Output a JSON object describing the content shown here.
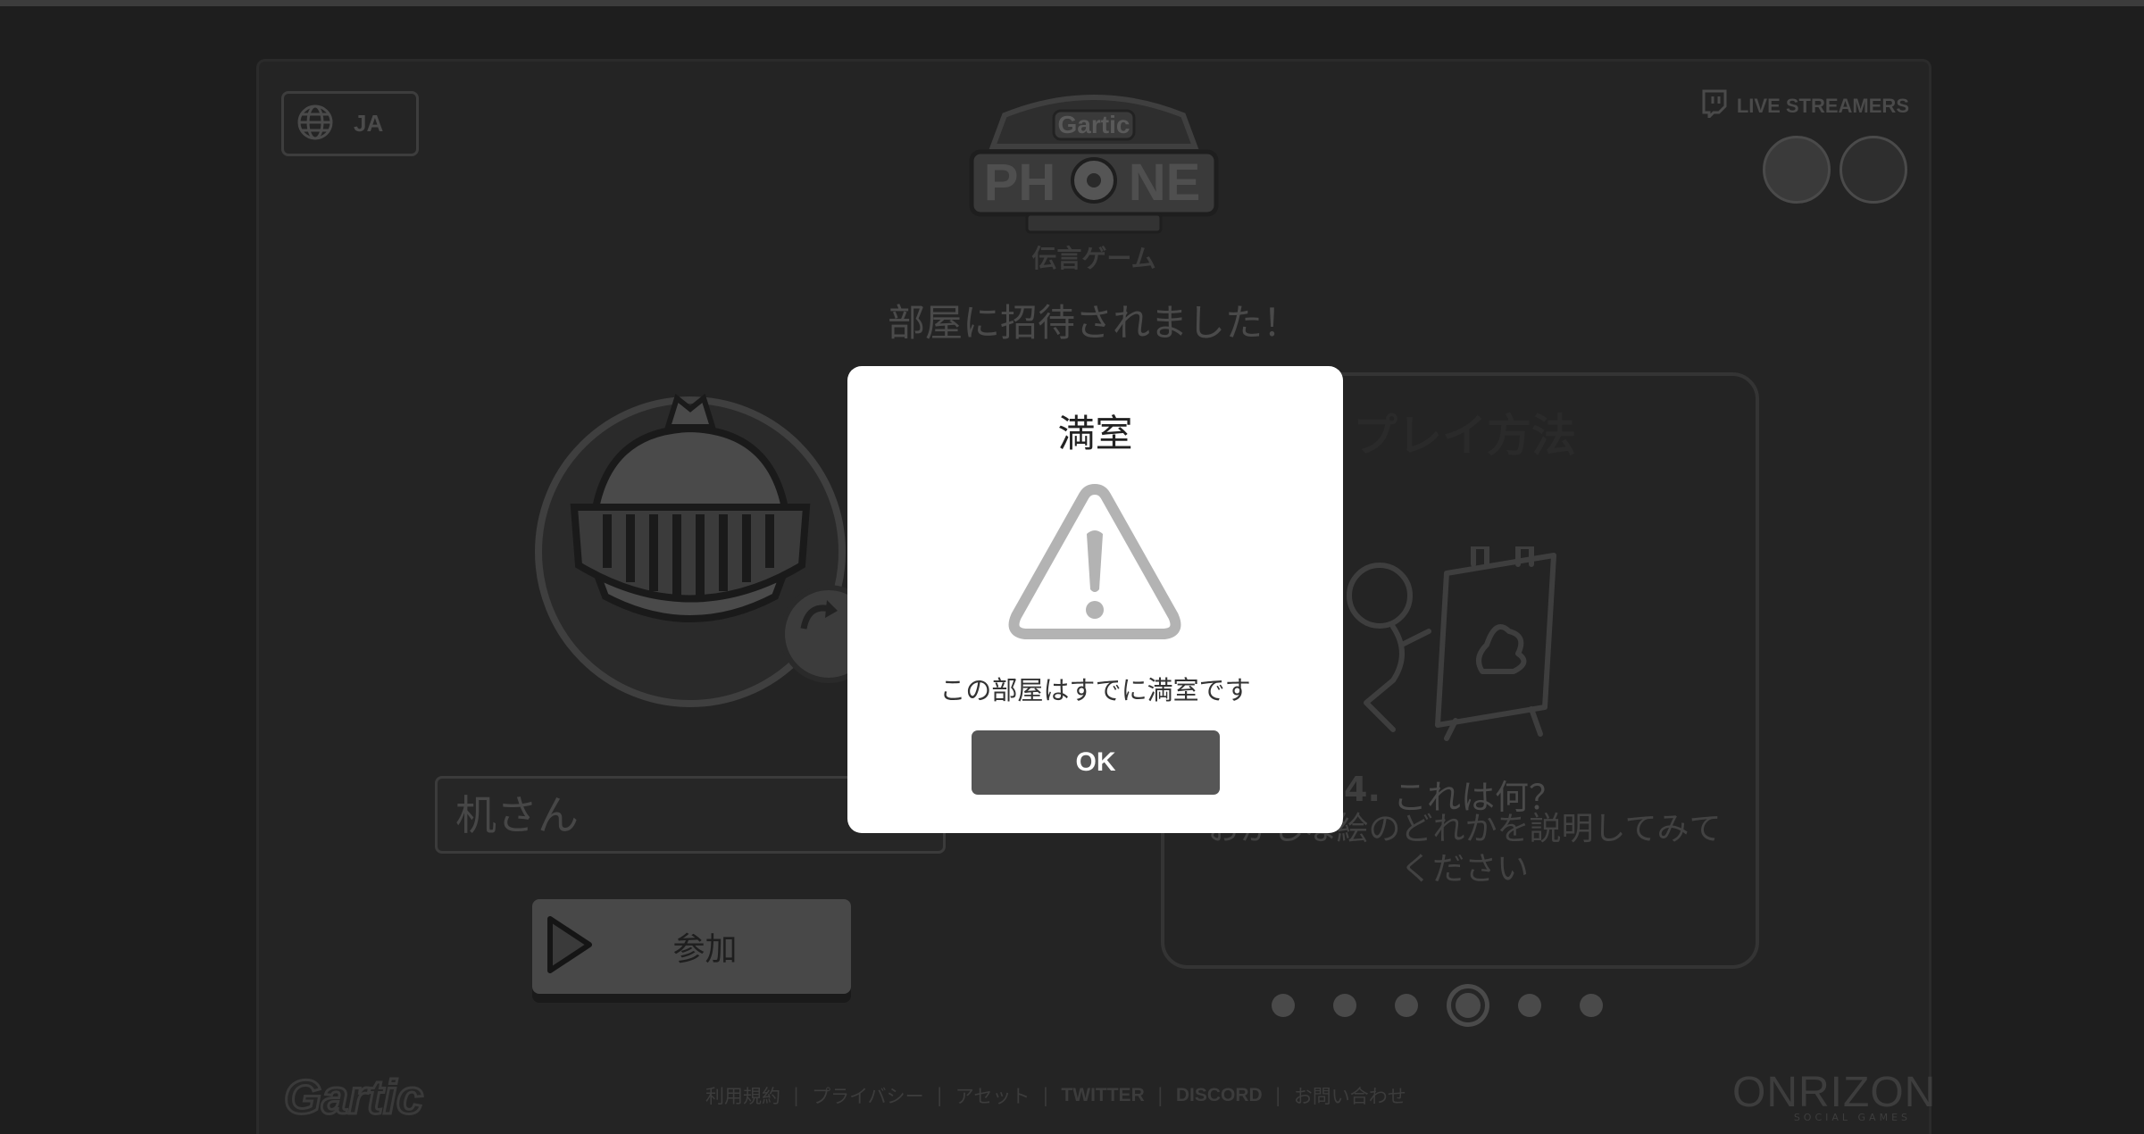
{
  "language": {
    "code": "JA"
  },
  "header": {
    "subtitle": "伝言ゲーム",
    "invite_message": "部屋に招待されました！",
    "live_streamers_label": "LIVE STREAMERS"
  },
  "player": {
    "name_placeholder": "机さん",
    "join_label": "参加"
  },
  "how_to_play": {
    "title": "プレイ方法",
    "step_number": "4.",
    "step_title": "これは何？",
    "step_description": "おかしな絵のどれかを説明してみてください",
    "dots_total": 6,
    "active_index": 3
  },
  "footer": {
    "links": [
      {
        "label": "利用規約"
      },
      {
        "label": "プライバシー"
      },
      {
        "label": "アセット"
      },
      {
        "label": "TWITTER"
      },
      {
        "label": "DISCORD"
      },
      {
        "label": "お問い合わせ"
      }
    ],
    "left_logo": "Gartic",
    "right_logo": "ONRIZON",
    "right_logo_sub": "SOCIAL GAMES"
  },
  "modal": {
    "title": "満室",
    "message": "この部屋はすでに満室です",
    "ok_label": "OK",
    "icon": "warning-icon"
  },
  "colors": {
    "overlay_background": "#1e1e1e",
    "modal_background": "#ffffff",
    "ok_button": "#565656",
    "warning_icon": "#b3b3b3"
  }
}
